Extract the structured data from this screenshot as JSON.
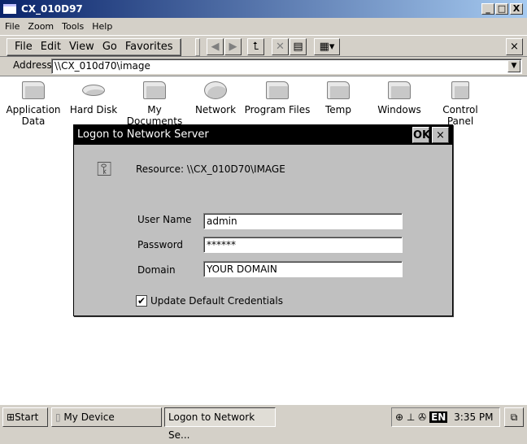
{
  "window": {
    "title": "CX_010D97",
    "minimize": "_",
    "maximize": "□",
    "close": "X"
  },
  "menu": [
    "File",
    "Zoom",
    "Tools",
    "Help"
  ],
  "command_bar": [
    "File",
    "Edit",
    "View",
    "Go",
    "Favorites"
  ],
  "toolbar_icons": [
    "back-icon",
    "forward-icon",
    "up-folder-icon",
    "delete-icon",
    "properties-icon",
    "view-icon"
  ],
  "toolbar_close": "×",
  "address": {
    "label": "Address",
    "value": "\\\\CX_010d70\\image"
  },
  "items": [
    {
      "label": "Application Data",
      "icon": "folder-icon"
    },
    {
      "label": "Hard Disk",
      "icon": "hard-disk-icon"
    },
    {
      "label": "My Documents",
      "icon": "folder-icon"
    },
    {
      "label": "Network",
      "icon": "network-icon"
    },
    {
      "label": "Program Files",
      "icon": "folder-icon"
    },
    {
      "label": "Temp",
      "icon": "folder-icon"
    },
    {
      "label": "Windows",
      "icon": "folder-icon"
    },
    {
      "label": "Control Panel",
      "icon": "control-panel-icon"
    }
  ],
  "dialog": {
    "title": "Logon to Network Server",
    "ok": "OK",
    "close": "×",
    "resource": "Resource:  \\\\CX_010D70\\IMAGE",
    "user_label": "User Name",
    "user_value": "admin",
    "password_label": "Password",
    "password_value": "******",
    "domain_label": "Domain",
    "domain_value": "YOUR DOMAIN",
    "checkbox_label": "Update Default Credentials",
    "checkbox_checked": true,
    "check_mark": "✔"
  },
  "taskbar": {
    "start": "Start",
    "tasks": [
      "My Device",
      "Logon to Network Se..."
    ],
    "lang": "EN",
    "time": "3:35 PM"
  }
}
